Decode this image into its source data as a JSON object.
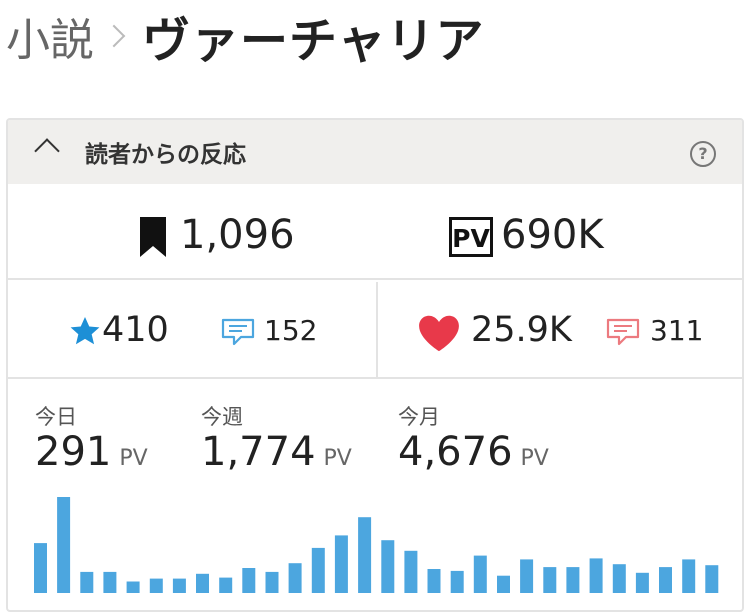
{
  "breadcrumb": {
    "parent": "小説",
    "title": "ヴァーチャリア"
  },
  "reactions": {
    "header": "読者からの反応",
    "help_symbol": "?",
    "bookmarks": "1,096",
    "pv_icon_label": "PV",
    "pv_total": "690K",
    "stars": "410",
    "star_comments": "152",
    "hearts": "25.9K",
    "heart_comments": "311"
  },
  "pv_stats": {
    "today": {
      "label": "今日",
      "value": "291",
      "unit": "PV"
    },
    "week": {
      "label": "今週",
      "value": "1,774",
      "unit": "PV"
    },
    "month": {
      "label": "今月",
      "value": "4,676",
      "unit": "PV"
    }
  },
  "colors": {
    "accent_blue": "#4ca6df",
    "star": "#1d8fd6",
    "heart": "#e8394a",
    "comment_red": "#ec7a7f"
  },
  "chart_data": {
    "type": "bar",
    "values": [
      52,
      100,
      22,
      22,
      12,
      15,
      15,
      20,
      16,
      26,
      22,
      31,
      47,
      60,
      79,
      55,
      44,
      25,
      23,
      39,
      18,
      35,
      27,
      27,
      36,
      30,
      21,
      27,
      35,
      29
    ],
    "ylim": [
      0,
      100
    ],
    "grid": false
  }
}
